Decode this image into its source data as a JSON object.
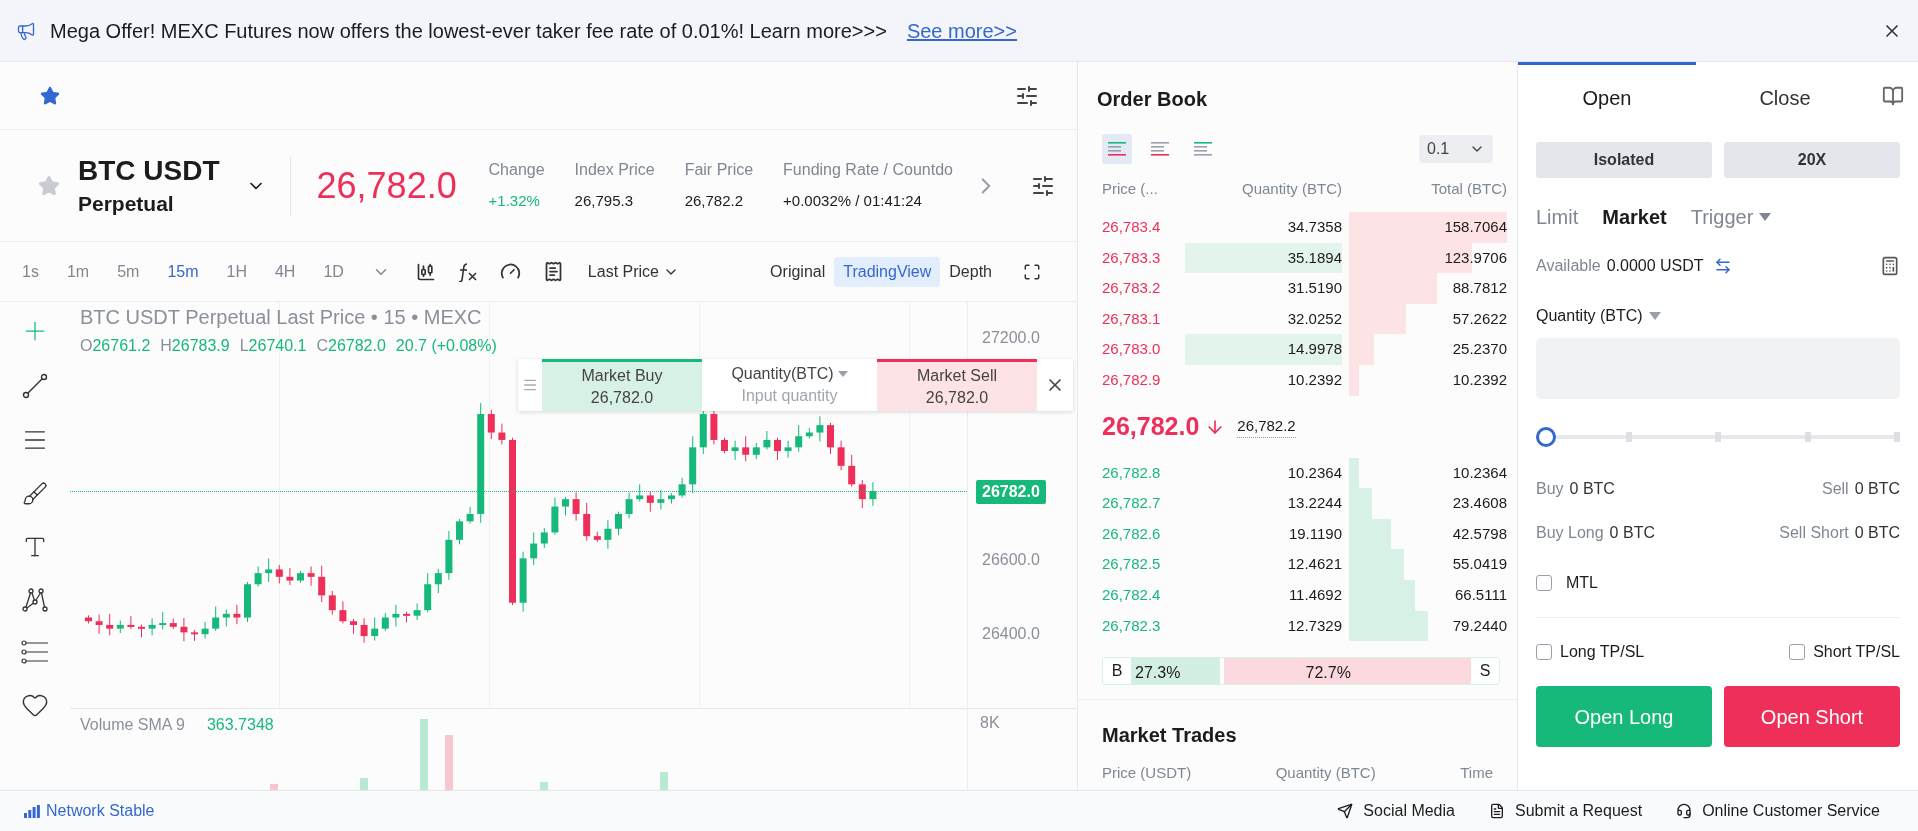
{
  "banner": {
    "message": "Mega Offer! MEXC Futures now offers the lowest-ever taker fee rate of 0.01%! Learn more>>>",
    "link": "See more>>"
  },
  "ticker": {
    "symbol": "BTC USDT",
    "contract": "Perpetual",
    "favorite": false,
    "price": "26,782.0",
    "falling": true,
    "stats": [
      {
        "label": "Change",
        "value": "+1.32%",
        "positive": true
      },
      {
        "label": "Index Price",
        "value": "26,795.3",
        "positive": false
      },
      {
        "label": "Fair Price",
        "value": "26,782.2",
        "positive": false
      },
      {
        "label": "Funding Rate / Countdo",
        "value": "+0.0032% / 01:41:24",
        "positive": false
      }
    ]
  },
  "timeframes": [
    {
      "label": "1s",
      "selected": false
    },
    {
      "label": "1m",
      "selected": false
    },
    {
      "label": "5m",
      "selected": false
    },
    {
      "label": "15m",
      "selected": true
    },
    {
      "label": "1H",
      "selected": false
    },
    {
      "label": "4H",
      "selected": false
    },
    {
      "label": "1D",
      "selected": false
    }
  ],
  "price_type": "Last Price",
  "views": [
    {
      "label": "Original",
      "selected": false
    },
    {
      "label": "TradingView",
      "selected": true
    },
    {
      "label": "Depth",
      "selected": false
    }
  ],
  "chart": {
    "title": "BTC USDT Perpetual Last Price • 15 • MEXC",
    "ohlc": [
      {
        "label": "O",
        "value": "26761.2"
      },
      {
        "label": "H",
        "value": "26783.9"
      },
      {
        "label": "L",
        "value": "26740.1"
      },
      {
        "label": "C",
        "value": "26782.0"
      }
    ],
    "change": "20.7 (+0.08%)",
    "price_axis": [
      "27200.0",
      "26600.0",
      "26400.0"
    ],
    "last_price_tag": "26782.0",
    "volume_label": "Volume SMA 9",
    "volume_value": "363.7348",
    "volume_axis": [
      "8K"
    ]
  },
  "quick_order": {
    "buy_label": "Market Buy",
    "buy_price": "26,782.0",
    "quantity_label": "Quantity(BTC)",
    "quantity_placeholder": "Input quantity",
    "sell_label": "Market Sell",
    "sell_price": "26,782.0"
  },
  "order_book": {
    "title": "Order Book",
    "modes": [
      {
        "kind": "both",
        "selected": true
      },
      {
        "kind": "asks",
        "selected": false
      },
      {
        "kind": "bids",
        "selected": false
      }
    ],
    "precision": "0.1",
    "columns": [
      "Price (...",
      "Quantity (BTC)",
      "Total (BTC)"
    ],
    "asks": [
      {
        "price": "26,783.4",
        "quantity": "34.7358",
        "total": "158.7064",
        "highlighted": false
      },
      {
        "price": "26,783.3",
        "quantity": "35.1894",
        "total": "123.9706",
        "highlighted": true
      },
      {
        "price": "26,783.2",
        "quantity": "31.5190",
        "total": "88.7812",
        "highlighted": false
      },
      {
        "price": "26,783.1",
        "quantity": "32.0252",
        "total": "57.2622",
        "highlighted": false
      },
      {
        "price": "26,783.0",
        "quantity": "14.9978",
        "total": "25.2370",
        "highlighted": true
      },
      {
        "price": "26,782.9",
        "quantity": "10.2392",
        "total": "10.2392",
        "highlighted": false
      }
    ],
    "last_price": "26,782.0",
    "falling": true,
    "mark_price": "26,782.2",
    "bids": [
      {
        "price": "26,782.8",
        "quantity": "10.2364",
        "total": "10.2364",
        "highlighted": false
      },
      {
        "price": "26,782.7",
        "quantity": "13.2244",
        "total": "23.4608",
        "highlighted": false
      },
      {
        "price": "26,782.6",
        "quantity": "19.1190",
        "total": "42.5798",
        "highlighted": false
      },
      {
        "price": "26,782.5",
        "quantity": "12.4621",
        "total": "55.0419",
        "highlighted": false
      },
      {
        "price": "26,782.4",
        "quantity": "11.4692",
        "total": "66.5111",
        "highlighted": false
      },
      {
        "price": "26,782.3",
        "quantity": "12.7329",
        "total": "79.2440",
        "highlighted": false
      }
    ],
    "buy_ratio": {
      "label": "B",
      "value": "27.3%",
      "level": 0.273
    },
    "sell_ratio": {
      "label": "S",
      "value": "72.7%"
    }
  },
  "market_trades": {
    "title": "Market Trades",
    "columns": [
      "Price (USDT)",
      "Quantity (BTC)",
      "Time"
    ]
  },
  "trade_panel": {
    "tabs": [
      {
        "label": "Open",
        "selected": true
      },
      {
        "label": "Close",
        "selected": false
      }
    ],
    "margin_mode": "Isolated",
    "leverage": "20X",
    "order_types": [
      {
        "label": "Limit",
        "selected": false,
        "dropdown": false
      },
      {
        "label": "Market",
        "selected": true,
        "dropdown": false
      },
      {
        "label": "Trigger",
        "selected": false,
        "dropdown": true
      }
    ],
    "available_label": "Available",
    "available_value": "0.0000 USDT",
    "quantity_label": "Quantity (BTC)",
    "slider": {
      "level": 0
    },
    "info": [
      {
        "left_label": "Buy",
        "left_value": "0 BTC",
        "right_label": "Sell",
        "right_value": "0 BTC"
      },
      {
        "left_label": "Buy Long",
        "left_value": "0 BTC",
        "right_label": "Sell Short",
        "right_value": "0 BTC"
      }
    ],
    "mtl": {
      "label": "MTL",
      "checked": false
    },
    "tpsl": [
      {
        "label": "Long TP/SL",
        "checked": false
      },
      {
        "label": "Short TP/SL",
        "checked": false
      }
    ],
    "buttons": [
      {
        "label": "Open Long",
        "kind": "long"
      },
      {
        "label": "Open Short",
        "kind": "short"
      }
    ]
  },
  "footer": {
    "network": "Network Stable",
    "links": [
      {
        "label": "Social Media",
        "kind": "social"
      },
      {
        "label": "Submit a Request",
        "kind": "request"
      },
      {
        "label": "Online Customer Service",
        "kind": "support"
      }
    ]
  }
}
